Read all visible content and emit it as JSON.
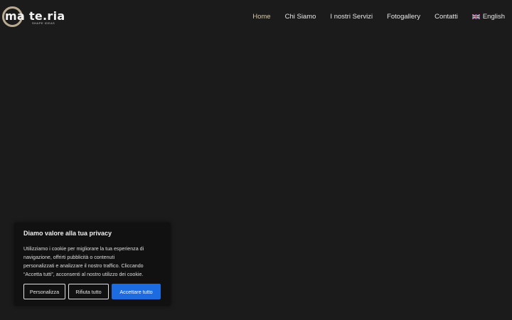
{
  "logo": {
    "text": "ma te.ria",
    "tagline": "SHAPE IDEAS"
  },
  "nav": {
    "items": [
      {
        "label": "Home",
        "active": true
      },
      {
        "label": "Chi Siamo",
        "active": false
      },
      {
        "label": "I nostri Servizi",
        "active": false
      },
      {
        "label": "Fotogallery",
        "active": false
      },
      {
        "label": "Contatti",
        "active": false
      }
    ],
    "language": {
      "label": "English",
      "icon": "uk-flag-icon"
    }
  },
  "cookie_banner": {
    "title": "Diamo valore alla tua privacy",
    "text": "Utilizziamo i cookie per migliorare la tua esperienza di\nnavigazione, offrirti pubblicità o contenuti\npersonalizzati e analizzare il nostro traffico. Cliccando\n“Accetta tutti”, acconsenti al nostro utilizzo dei cookie.",
    "buttons": {
      "customize": "Personalizza",
      "reject": "Rifiuta tutto",
      "accept": "Accettare tutto"
    }
  },
  "colors": {
    "background": "#1b1b1b",
    "accent_nav": "#d8c9a6",
    "logo_ring": "#b8ab92",
    "primary_button": "#1d6be0"
  }
}
